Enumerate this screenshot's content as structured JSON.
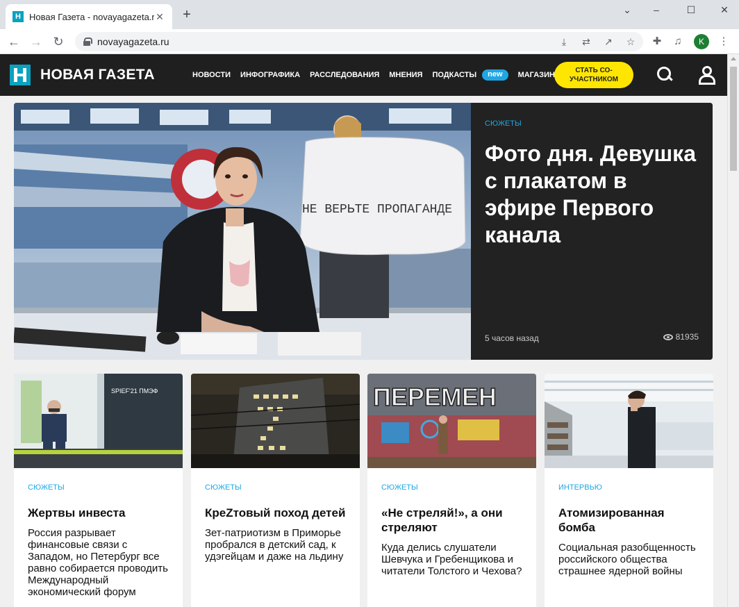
{
  "browser": {
    "tab_title": "Новая Газета - novayagazeta.ru",
    "tab_favicon_letter": "Н",
    "url": "novayagazeta.ru",
    "profile_initial": "K"
  },
  "header": {
    "logo_text": "НОВАЯ ГАЗЕТА",
    "nav": [
      "НОВОСТИ",
      "ИНФОГРАФИКА",
      "РАССЛЕДОВАНИЯ",
      "МНЕНИЯ",
      "ПОДКАСТЫ"
    ],
    "new_badge": "new",
    "shop": "МАГАЗИН",
    "cta": "СТАТЬ СО-\nУЧАСТНИКОМ",
    "accent": "#1ea7e4",
    "cta_color": "#ffe600"
  },
  "hero": {
    "category": "СЮЖЕТЫ",
    "title": "Фото дня. Девушка с плакатом в эфире Первого канала",
    "poster_text": "НЕ ВЕРЬТЕ ПРОПАГАНДЕ",
    "time": "5 часов назад",
    "views": "81935"
  },
  "cards": [
    {
      "category": "СЮЖЕТЫ",
      "title": "Жертвы инвеста",
      "lead": "Россия разрывает финансовые связи с Западом, но Петербург все равно собирается проводить Международный экономический форум",
      "img_sign": "SPIEF'21 ПМЭФ"
    },
    {
      "category": "СЮЖЕТЫ",
      "title": "КреZтовый поход детей",
      "lead": "Зет-патриотизм в Приморье пробрался в детский сад, к удэгейцам и даже на льдину"
    },
    {
      "category": "СЮЖЕТЫ",
      "title": "«Не стреляй!», а они стреляют",
      "lead": "Куда делись слушатели Шевчука и Гребенщикова и читатели Толстого и Чехова?",
      "img_sign": "ПЕРЕМЕН"
    },
    {
      "category": "ИНТЕРВЬЮ",
      "title": "Атомизированная бомба",
      "lead": "Социальная разобщенность российского общества страшнее ядерной войны"
    }
  ]
}
